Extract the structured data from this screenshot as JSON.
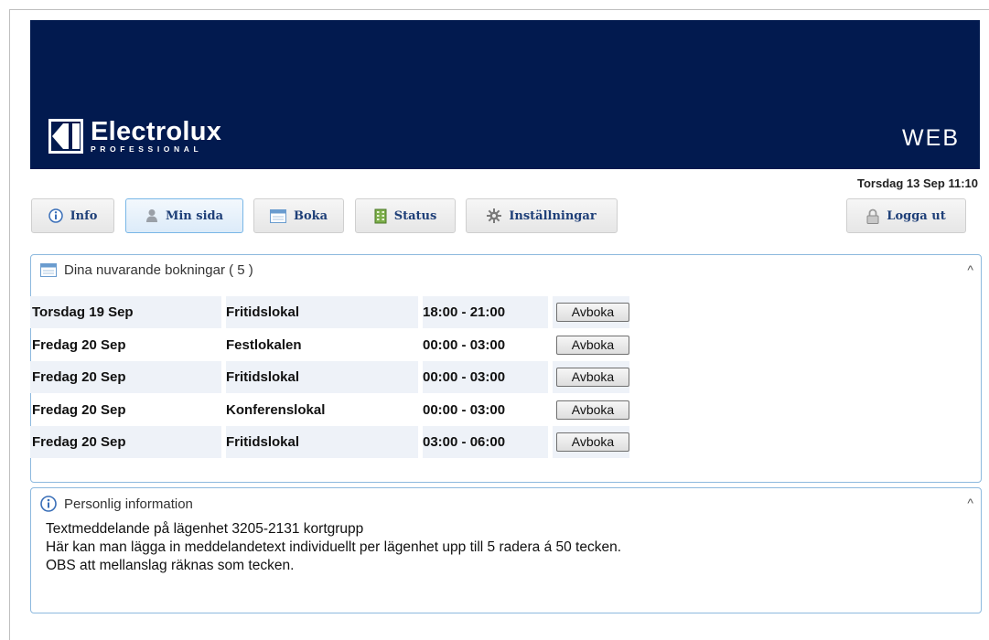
{
  "header": {
    "logo_name": "Electrolux",
    "logo_sub": "PROFESSIONAL",
    "web_label": "WEB",
    "datetime": "Torsdag 13 Sep 11:10"
  },
  "nav": {
    "info": "Info",
    "my_page": "Min sida",
    "book": "Boka",
    "status": "Status",
    "settings": "Inställningar",
    "logout": "Logga ut"
  },
  "bookings": {
    "title": "Dina nuvarande bokningar ( 5 )",
    "cancel_label": "Avboka",
    "rows": [
      {
        "date": "Torsdag 19 Sep",
        "room": "Fritidslokal",
        "time": "18:00 - 21:00"
      },
      {
        "date": "Fredag 20 Sep",
        "room": "Festlokalen",
        "time": "00:00 - 03:00"
      },
      {
        "date": "Fredag 20 Sep",
        "room": "Fritidslokal",
        "time": "00:00 - 03:00"
      },
      {
        "date": "Fredag 20 Sep",
        "room": "Konferenslokal",
        "time": "00:00 - 03:00"
      },
      {
        "date": "Fredag 20 Sep",
        "room": "Fritidslokal",
        "time": "03:00 - 06:00"
      }
    ]
  },
  "personal": {
    "title": "Personlig information",
    "lines": [
      "Textmeddelande på lägenhet 3205-2131 kortgrupp",
      "Här kan man lägga in meddelandetext individuellt per lägenhet upp till 5 radera á 50 tecken.",
      "OBS att mellanslag räknas som tecken."
    ]
  },
  "colors": {
    "banner": "#021a4f",
    "nav_text": "#1e3f78",
    "panel_border": "#8db9de",
    "row_shade": "#eef2f8"
  }
}
